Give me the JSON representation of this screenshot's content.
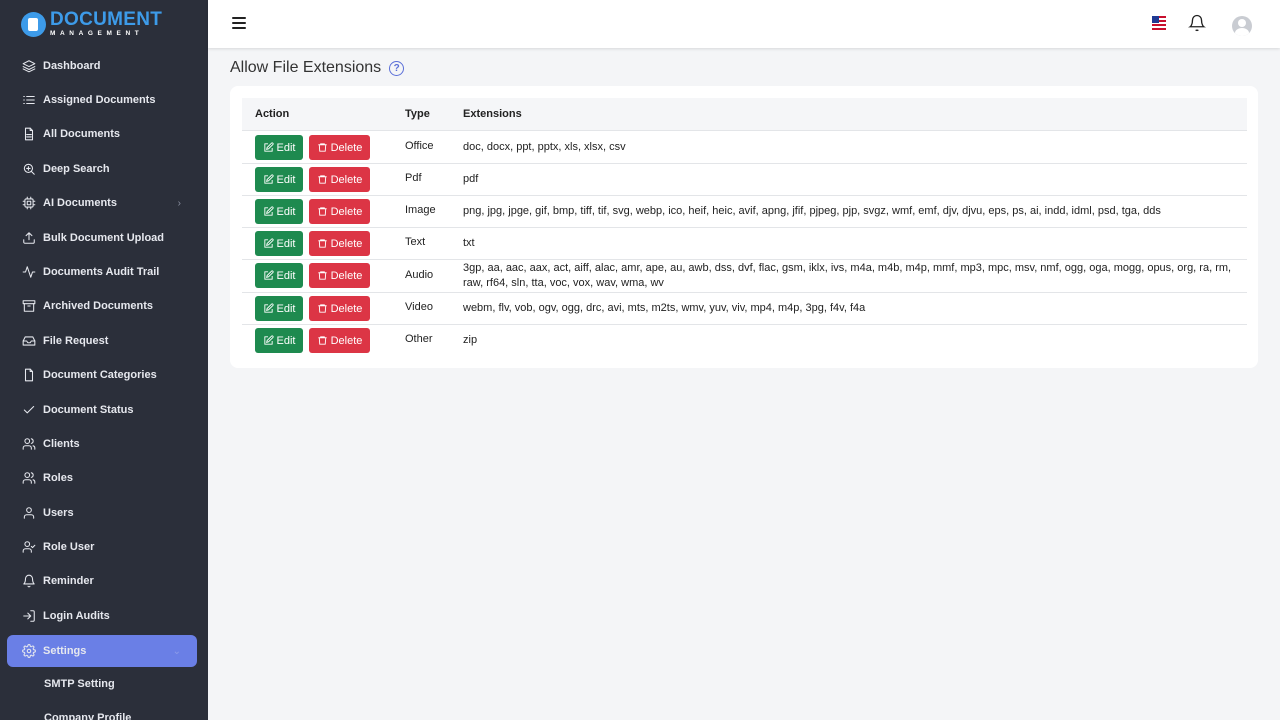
{
  "app": {
    "logo_line1": "DOCUMENT",
    "logo_line2": "MANAGEMENT"
  },
  "sidebar": {
    "items": [
      {
        "label": "Dashboard",
        "icon": "layers-icon"
      },
      {
        "label": "Assigned Documents",
        "icon": "list-icon"
      },
      {
        "label": "All Documents",
        "icon": "file-text-icon"
      },
      {
        "label": "Deep Search",
        "icon": "search-plus-icon"
      },
      {
        "label": "AI Documents",
        "icon": "cpu-icon",
        "has_submenu": true
      },
      {
        "label": "Bulk Document Upload",
        "icon": "upload-icon"
      },
      {
        "label": "Documents Audit Trail",
        "icon": "activity-icon"
      },
      {
        "label": "Archived Documents",
        "icon": "archive-icon"
      },
      {
        "label": "File Request",
        "icon": "inbox-icon"
      },
      {
        "label": "Document Categories",
        "icon": "file-icon"
      },
      {
        "label": "Document Status",
        "icon": "check-icon"
      },
      {
        "label": "Clients",
        "icon": "users-icon"
      },
      {
        "label": "Roles",
        "icon": "users-icon"
      },
      {
        "label": "Users",
        "icon": "user-icon"
      },
      {
        "label": "Role User",
        "icon": "user-check-icon"
      },
      {
        "label": "Reminder",
        "icon": "bell-icon"
      },
      {
        "label": "Login Audits",
        "icon": "log-in-icon"
      },
      {
        "label": "Settings",
        "icon": "gear-icon",
        "active": true,
        "has_submenu": true
      }
    ],
    "sub_items": [
      "SMTP Setting",
      "Company Profile"
    ]
  },
  "topbar": {
    "flag_icon": "us-flag-icon",
    "bell_icon": "bell-icon",
    "avatar_icon": "avatar-icon"
  },
  "page": {
    "title": "Allow File Extensions",
    "help": "?"
  },
  "table": {
    "headers": [
      "Action",
      "Type",
      "Extensions"
    ],
    "edit_label": "Edit",
    "delete_label": "Delete",
    "rows": [
      {
        "type": "Office",
        "extensions": "doc, docx, ppt, pptx, xls, xlsx, csv"
      },
      {
        "type": "Pdf",
        "extensions": "pdf"
      },
      {
        "type": "Image",
        "extensions": "png, jpg, jpge, gif, bmp, tiff, tif, svg, webp, ico, heif, heic, avif, apng, jfif, pjpeg, pjp, svgz, wmf, emf, djv, djvu, eps, ps, ai, indd, idml, psd, tga, dds"
      },
      {
        "type": "Text",
        "extensions": "txt"
      },
      {
        "type": "Audio",
        "extensions": "3gp, aa, aac, aax, act, aiff, alac, amr, ape, au, awb, dss, dvf, flac, gsm, iklx, ivs, m4a, m4b, m4p, mmf, mp3, mpc, msv, nmf, ogg, oga, mogg, opus, org, ra, rm, raw, rf64, sln, tta, voc, vox, wav, wma, wv"
      },
      {
        "type": "Video",
        "extensions": "webm, flv, vob, ogv, ogg, drc, avi, mts, m2ts, wmv, yuv, viv, mp4, m4p, 3pg, f4v, f4a"
      },
      {
        "type": "Other",
        "extensions": "zip"
      }
    ]
  },
  "colors": {
    "sidebar_bg": "#2b2f3a",
    "active": "#6a7fe6",
    "edit": "#1e8a4f",
    "delete": "#dc3545",
    "brand": "#3d9be9"
  }
}
